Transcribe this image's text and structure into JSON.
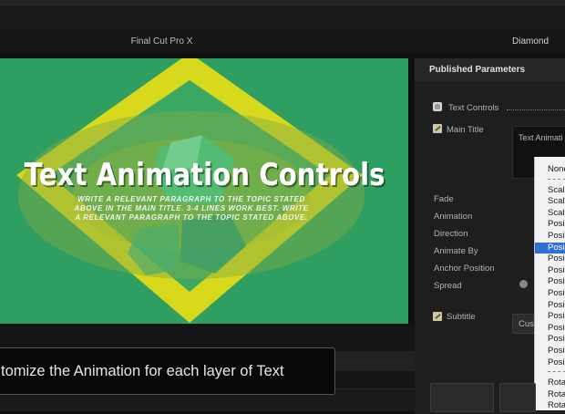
{
  "app_title": "Final Cut Pro X",
  "project_title": "Diamond",
  "viewer": {
    "title": "Text Animation Controls",
    "paragraph": "WRITE A RELEVANT PARAGRAPH TO THE TOPIC STATED ABOVE IN THE MAIN TITLE. 3-4 LINES WORK BEST. WRITE A RELEVANT PARAGRAPH TO THE TOPIC STATED ABOVE."
  },
  "inspector": {
    "header": "Published Parameters",
    "text_controls": "Text Controls",
    "main_title": "Main Title",
    "popup_label": "Text Animati",
    "params": [
      "Fade",
      "Animation",
      "Direction",
      "Animate By",
      "Anchor Position",
      "Spread"
    ],
    "subtitle": "Subtitle",
    "custom_button": "Cus"
  },
  "dropdown": {
    "items": [
      "None",
      "---",
      "Scal",
      "Scal",
      "Scal",
      "Posi",
      "Posi",
      "Posi",
      "Posi",
      "Posi",
      "Posi",
      "Posi",
      "Posi",
      "Posi",
      "Posi",
      "Posi",
      "Posi",
      "Posi",
      "---",
      "Rota",
      "Rota",
      "Rota"
    ],
    "selected_index": 7
  },
  "banner_text": "tomize the Animation for each layer of Text",
  "colors": {
    "accent_green": "#2e9f60",
    "diamond_yellow": "#d8d81c",
    "selection_blue": "#2f6fd6"
  }
}
